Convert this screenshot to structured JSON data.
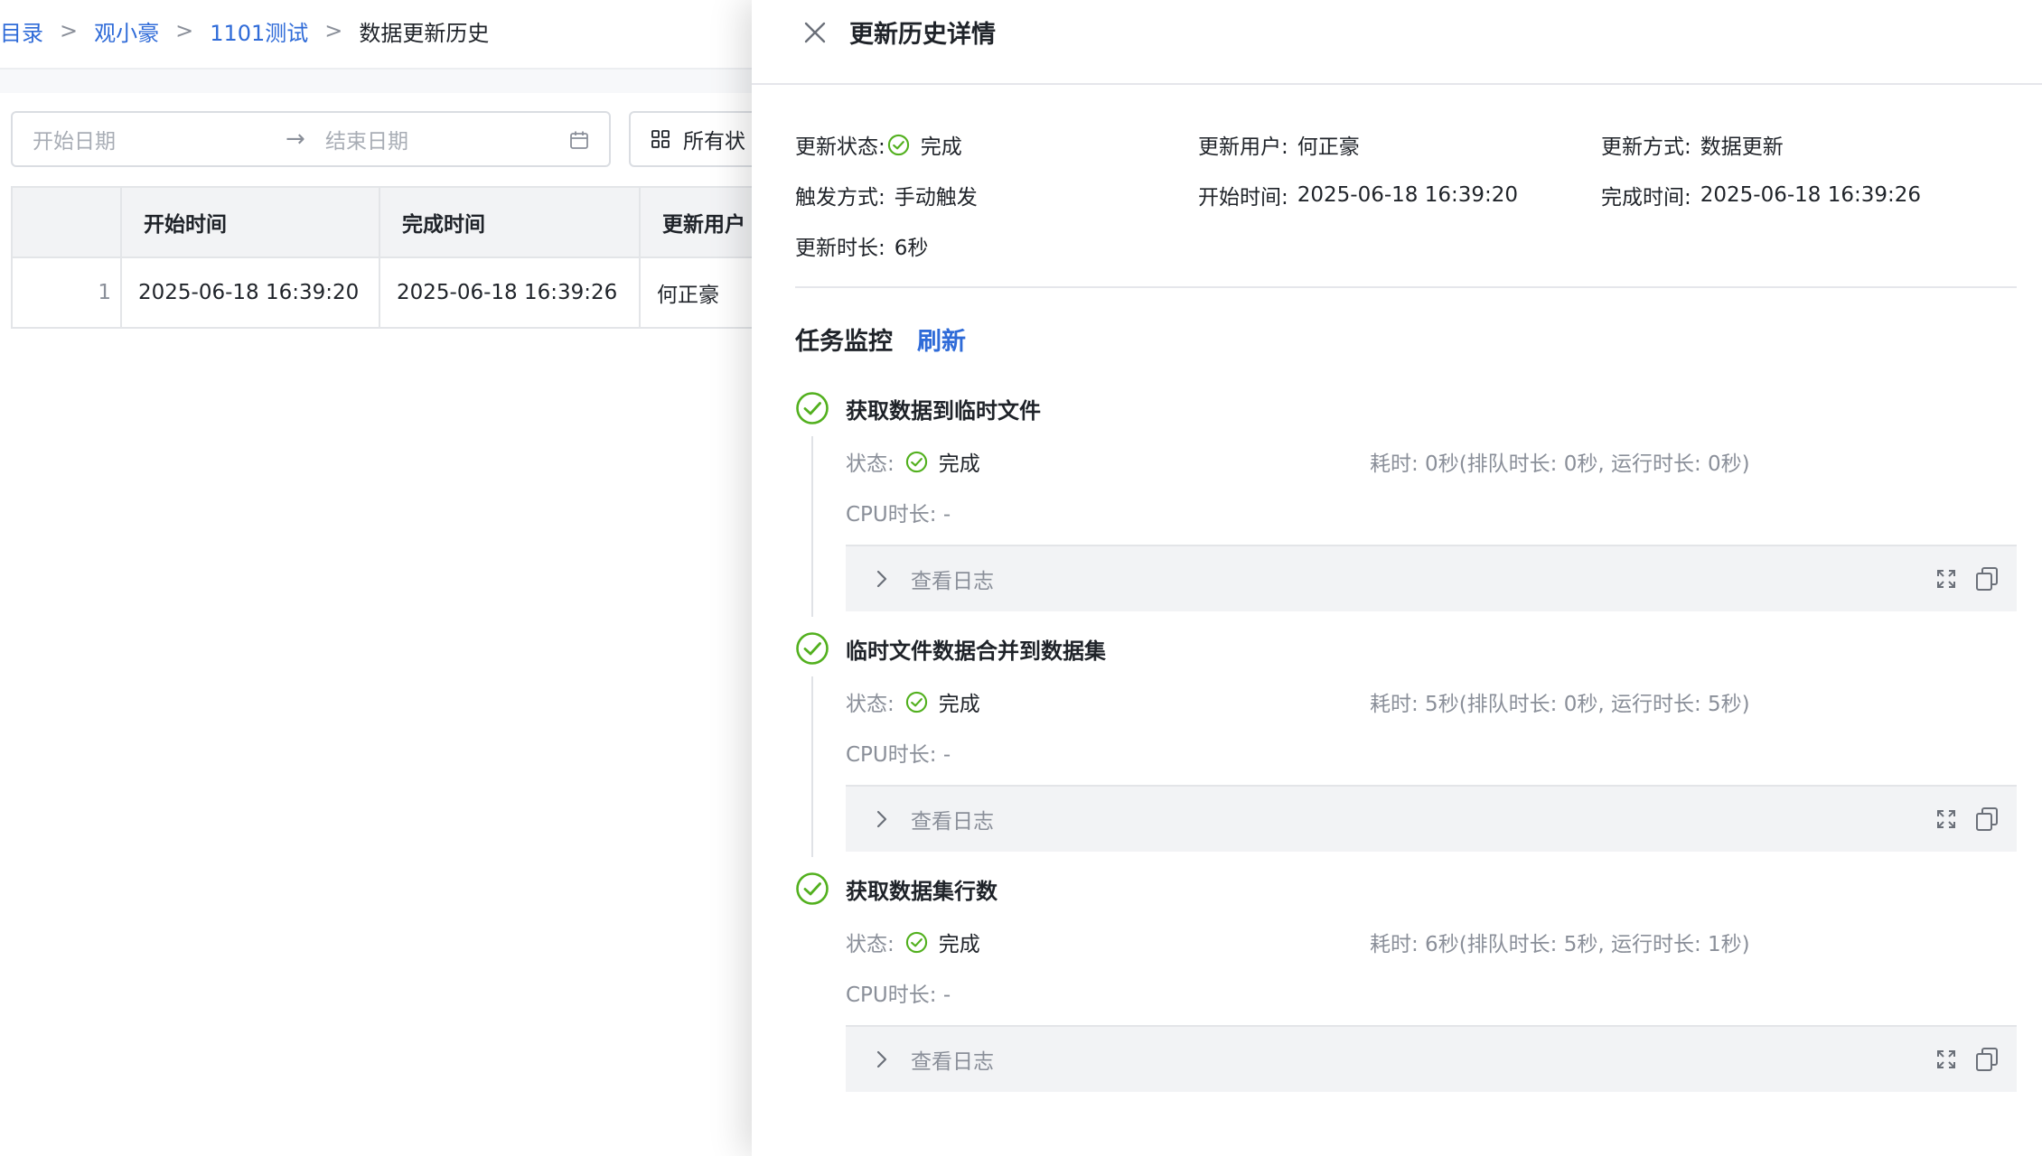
{
  "breadcrumb": {
    "items": [
      "根目录",
      "观小豪",
      "1101测试"
    ],
    "separator": ">",
    "current": "数据更新历史"
  },
  "filters": {
    "start_placeholder": "开始日期",
    "arrow": "→",
    "end_placeholder": "结束日期",
    "status_label": "所有状"
  },
  "table": {
    "headers": [
      "",
      "开始时间",
      "完成时间",
      "更新用户"
    ],
    "rows": [
      {
        "index": "1",
        "start": "2025-06-18 16:39:20",
        "end": "2025-06-18 16:39:26",
        "user": "何正豪"
      }
    ]
  },
  "drawer": {
    "title": "更新历史详情",
    "info": {
      "status_label": "更新状态:",
      "status_value": "完成",
      "user_label": "更新用户:",
      "user_value": "何正豪",
      "method_label": "更新方式:",
      "method_value": "数据更新",
      "trigger_label": "触发方式:",
      "trigger_value": "手动触发",
      "start_label": "开始时间:",
      "start_value": "2025-06-18 16:39:20",
      "end_label": "完成时间:",
      "end_value": "2025-06-18 16:39:26",
      "duration_label": "更新时长:",
      "duration_value": "6秒"
    },
    "monitor_title": "任务监控",
    "refresh_label": "刷新",
    "tasks": [
      {
        "name": "获取数据到临时文件",
        "status_label": "状态:",
        "status_value": "完成",
        "duration": "耗时: 0秒(排队时长: 0秒, 运行时长: 0秒)",
        "cpu": "CPU时长: -",
        "log_label": "查看日志"
      },
      {
        "name": "临时文件数据合并到数据集",
        "status_label": "状态:",
        "status_value": "完成",
        "duration": "耗时: 5秒(排队时长: 0秒, 运行时长: 5秒)",
        "cpu": "CPU时长: -",
        "log_label": "查看日志"
      },
      {
        "name": "获取数据集行数",
        "status_label": "状态:",
        "status_value": "完成",
        "duration": "耗时: 6秒(排队时长: 5秒, 运行时长: 1秒)",
        "cpu": "CPU时长: -",
        "log_label": "查看日志"
      }
    ]
  },
  "colors": {
    "link": "#2f6bd8",
    "success": "#52b01e",
    "muted": "#8a8f99",
    "log_bg": "#f2f3f5"
  },
  "icons": [
    "close-icon",
    "calendar-icon",
    "grid-icon",
    "check-circle-icon",
    "chevron-right-icon",
    "expand-icon",
    "copy-icon"
  ]
}
